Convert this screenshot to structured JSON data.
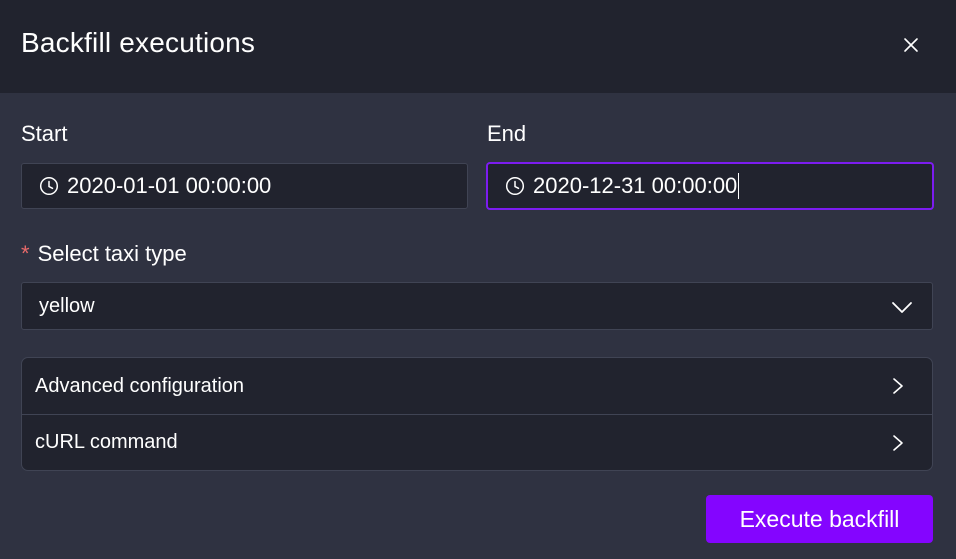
{
  "dialog": {
    "title": "Backfill executions",
    "close_icon": "close-icon"
  },
  "start": {
    "label": "Start",
    "value": "2020-01-01 00:00:00",
    "icon": "clock-icon"
  },
  "end": {
    "label": "End",
    "value": "2020-12-31 00:00:00",
    "icon": "clock-icon"
  },
  "taxi_type": {
    "required_mark": "*",
    "label": "Select taxi type",
    "selected": "yellow",
    "icon": "chevron-down-icon"
  },
  "sections": [
    {
      "label": "Advanced configuration",
      "icon": "chevron-right-icon"
    },
    {
      "label": "cURL command",
      "icon": "chevron-right-icon"
    }
  ],
  "actions": {
    "execute_label": "Execute backfill"
  },
  "colors": {
    "accent": "#8405ff",
    "focus_border": "#7c1cf0",
    "required": "#e86a6a",
    "background": "#2f3241",
    "header": "#21232e"
  }
}
